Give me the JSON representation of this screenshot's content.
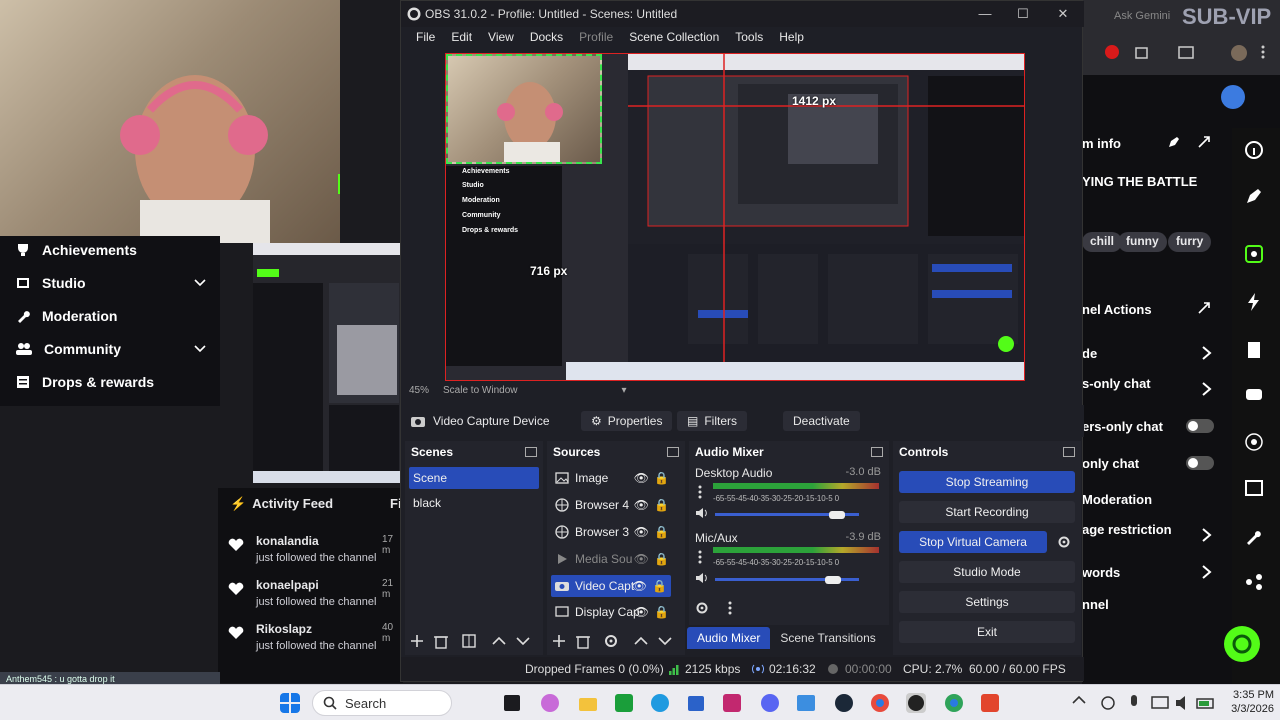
{
  "obs": {
    "title": "OBS 31.0.2 - Profile: Untitled - Scenes: Untitled",
    "menu": [
      "File",
      "Edit",
      "View",
      "Docks",
      "Profile",
      "Scene Collection",
      "Tools",
      "Help"
    ],
    "preview": {
      "zoom": "45%",
      "scale_mode": "Scale to Window",
      "width_label": "1412 px",
      "height_label": "716 px"
    },
    "source_bar": {
      "source_name": "Video Capture Device",
      "properties": "Properties",
      "filters": "Filters",
      "deactivate": "Deactivate"
    },
    "scenes": {
      "title": "Scenes",
      "items": [
        "Scene",
        "black"
      ],
      "selected": 0
    },
    "sources": {
      "title": "Sources",
      "items": [
        {
          "name": "Image",
          "icon": "image-icon"
        },
        {
          "name": "Browser 4",
          "icon": "globe-icon"
        },
        {
          "name": "Browser 3",
          "icon": "globe-icon"
        },
        {
          "name": "Media Sou",
          "icon": "play-icon"
        },
        {
          "name": "Video Capt",
          "icon": "camera-icon"
        },
        {
          "name": "Display Cap",
          "icon": "monitor-icon"
        }
      ],
      "selected": 4
    },
    "mixer": {
      "title": "Audio Mixer",
      "scale": "-65-55-45-40-35-30-25-20-15-10-5 0",
      "channels": [
        {
          "name": "Desktop Audio",
          "db": "-3.0 dB",
          "level": 0.85
        },
        {
          "name": "Mic/Aux",
          "db": "-3.9 dB",
          "level": 0.82
        }
      ]
    },
    "controls": {
      "title": "Controls",
      "stop_streaming": "Stop Streaming",
      "start_recording": "Start Recording",
      "stop_virtual_camera": "Stop Virtual Camera",
      "studio_mode": "Studio Mode",
      "settings": "Settings",
      "exit": "Exit"
    },
    "tabs": [
      "Audio Mixer",
      "Scene Transitions"
    ],
    "status": {
      "dropped": "Dropped Frames 0 (0.0%)",
      "bitrate": "2125 kbps",
      "stream_time": "02:16:32",
      "record_time": "00:00:00",
      "cpu": "CPU: 2.7%",
      "fps": "60.00 / 60.00 FPS"
    }
  },
  "left_nav": {
    "items": [
      {
        "label": "Achievements",
        "icon": "trophy-icon",
        "chevron": false
      },
      {
        "label": "Studio",
        "icon": "film-icon",
        "chevron": true
      },
      {
        "label": "Moderation",
        "icon": "wrench-icon",
        "chevron": false
      },
      {
        "label": "Community",
        "icon": "people-icon",
        "chevron": true
      },
      {
        "label": "Drops & rewards",
        "icon": "list-icon",
        "chevron": false
      }
    ]
  },
  "activity_feed": {
    "title": "Activity Feed",
    "filter_label": "Fi",
    "items": [
      {
        "name": "konalandia",
        "action": "just followed the channel",
        "time": "17 m"
      },
      {
        "name": "konaelpapi",
        "action": "just followed the channel",
        "time": "21 m"
      },
      {
        "name": "Rikoslapz",
        "action": "just followed the channel",
        "time": "40 m"
      }
    ]
  },
  "chat_ticker": "Anthem545 : u gotta drop it",
  "right_panel": {
    "top_text": "Ask Gemini",
    "watermark": "SUB-VIP",
    "stream_info": "m info",
    "stream_title": "YING THE BATTLE",
    "tags": [
      "chill",
      "funny",
      "furry"
    ],
    "channel_actions": "nel Actions",
    "rows": [
      "de",
      "s-only chat",
      "ers-only chat",
      "only chat",
      "Moderation",
      "age restriction",
      "words",
      "nnel"
    ]
  },
  "taskbar": {
    "search": "Search",
    "time": "3:35 PM",
    "date": "3/3/2026"
  },
  "colors": {
    "accent": "#284cb8",
    "obs_bg": "#1e1f26",
    "dock_bg": "#23242c",
    "kick_green": "#53fc18"
  }
}
